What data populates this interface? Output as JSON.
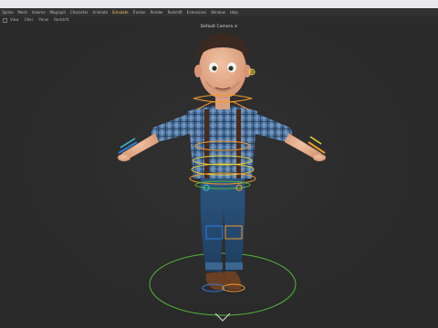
{
  "menubar": {
    "items": [
      "Spline",
      "Mesh",
      "Volume",
      "Mograph",
      "Character",
      "Animate",
      "Simulate",
      "Tracker",
      "Render",
      "Redshift",
      "Extensions",
      "Window",
      "Help"
    ],
    "active_index": 6
  },
  "toolbar": {
    "items": [
      "View",
      "Filter",
      "Panel",
      "Redshift"
    ]
  },
  "viewport": {
    "camera_label": "Default Camera ⊙"
  },
  "colors": {
    "accent_menu": "#f0c060",
    "viewport_bg": "#2a2a2a",
    "rig_orange": "#f59a2a",
    "rig_yellow": "#e8d23a",
    "rig_green": "#4fb83a",
    "rig_blue": "#2f7de0",
    "rig_cyan": "#33c6d8"
  }
}
